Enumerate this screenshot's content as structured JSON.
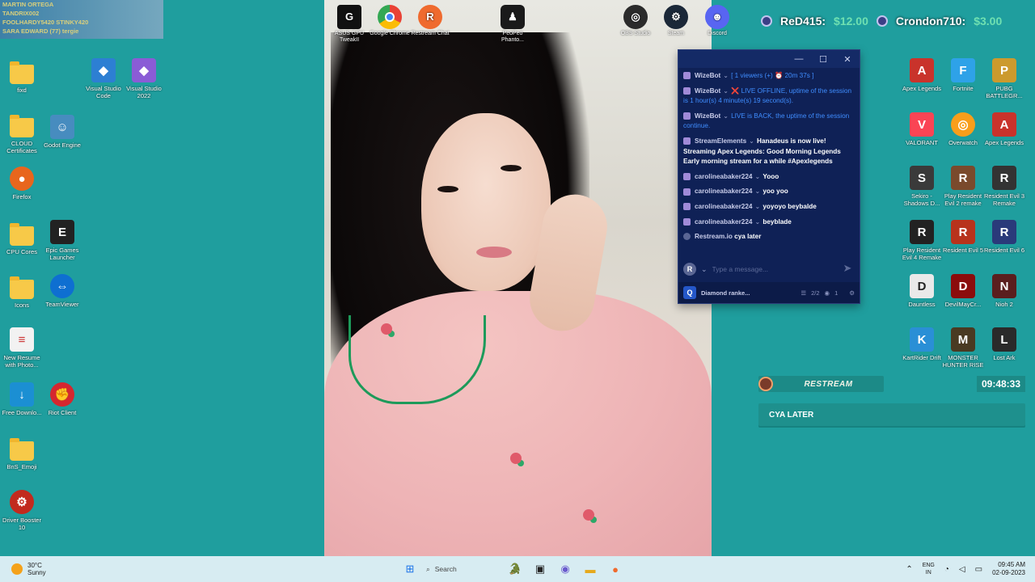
{
  "overlay": {
    "lines": [
      "MARTIN ORTEGA",
      "TANDRIX002",
      "FOOLHARDY5420 STINKY420",
      "SARA EDWARD (77) tergie"
    ]
  },
  "desktop_left": [
    {
      "label": "fixd",
      "type": "folder"
    },
    {
      "label": "Visual Studio Code",
      "type": "app",
      "color": "#2d7fd3",
      "glyph": "◆"
    },
    {
      "label": "Visual Studio 2022",
      "type": "app",
      "color": "#8a5cd6",
      "glyph": "◆"
    },
    {
      "label": "CLOUD Certificates",
      "type": "folder"
    },
    {
      "label": "Godot Engine",
      "type": "app",
      "color": "#478cbf",
      "glyph": "☺"
    },
    {
      "label": "Firefox",
      "type": "app",
      "color": "#e8661d",
      "glyph": "●"
    },
    {
      "label": "CPU Cores",
      "type": "folder"
    },
    {
      "label": "Epic Games Launcher",
      "type": "app",
      "color": "#222222",
      "glyph": "E"
    },
    {
      "label": "Icons",
      "type": "folder"
    },
    {
      "label": "TeamViewer",
      "type": "app",
      "color": "#0e6fd1",
      "glyph": "⇔"
    },
    {
      "label": "New Resume with Photo...",
      "type": "app",
      "color": "#f2f2f2",
      "glyph": "≡"
    },
    {
      "label": "Free Downlo...",
      "type": "app",
      "color": "#1b8fd3",
      "glyph": "↓"
    },
    {
      "label": "Riot Client",
      "type": "app",
      "color": "#d5272f",
      "glyph": "✊"
    },
    {
      "label": "BnS_Emoji",
      "type": "folder"
    },
    {
      "label": "Driver Booster 10",
      "type": "app",
      "color": "#c22a1e",
      "glyph": "⚙"
    }
  ],
  "top_icons": [
    {
      "label": "ASUS GPU TweakII",
      "color": "#111111",
      "glyph": "G"
    },
    {
      "label": "Google Chrome",
      "color": "#e94235",
      "glyph": "◉"
    },
    {
      "label": "Restream Chat",
      "color": "#ef6a2e",
      "glyph": "R"
    },
    {
      "label": "PeoPeo Phanto...",
      "color": "#1a1a1a",
      "glyph": "♟"
    },
    {
      "label": "OBS Studio",
      "color": "#2b2b2b",
      "glyph": "◎"
    },
    {
      "label": "Steam",
      "color": "#1b2838",
      "glyph": "⚙"
    },
    {
      "label": "Discord",
      "color": "#5865f2",
      "glyph": "☻"
    }
  ],
  "ticker": [
    {
      "name": "ReD415:",
      "amount": "$12.00"
    },
    {
      "name": "Crondon710:",
      "amount": "$3.00"
    }
  ],
  "chat": {
    "window_controls": {
      "minimize": "—",
      "maximize": "☐",
      "close": "✕"
    },
    "messages": [
      {
        "user": "WizeBot",
        "text": "[ 1 viewers (+) ⏰ 20m 37s ]",
        "system": true
      },
      {
        "user": "WizeBot",
        "text": "❌ LIVE OFFLINE, uptime of the session is 1 hour(s) 4 minute(s) 19 second(s).",
        "system": true
      },
      {
        "user": "WizeBot",
        "text": "LIVE is BACK, the uptime of the session continue.",
        "system": true
      },
      {
        "user": "StreamElements",
        "text": "Hanadeus is now live! Streaming Apex Legends: Good Morning Legends Early morning stream for a while #Apexlegends",
        "system": false
      },
      {
        "user": "carolineabaker224",
        "text": "Yooo",
        "system": false
      },
      {
        "user": "carolineabaker224",
        "text": "yoo yoo",
        "system": false
      },
      {
        "user": "carolineabaker224",
        "text": "yoyoyo beybalde",
        "system": false
      },
      {
        "user": "carolineabaker224",
        "text": "beyblade",
        "system": false
      },
      {
        "user": "Restream.io",
        "text": "cya later",
        "system": false
      }
    ],
    "input_badge": "R",
    "placeholder": "Type a message...",
    "footer": {
      "icon": "Q",
      "title": "Diamond ranke...",
      "count": "2/2",
      "viewers": "1"
    }
  },
  "restream_widget": {
    "title": "RESTREAM",
    "time": "09:48:33",
    "message": "CYA LATER"
  },
  "desktop_right": [
    {
      "label": "Apex Legends",
      "color": "#c9332b",
      "glyph": "A"
    },
    {
      "label": "Fortnite",
      "color": "#2ea2e8",
      "glyph": "F"
    },
    {
      "label": "PUBG BATTLEGR...",
      "color": "#cc9a2d",
      "glyph": "P"
    },
    {
      "label": "VALORANT",
      "color": "#fa4454",
      "glyph": "V"
    },
    {
      "label": "Overwatch",
      "color": "#f99e1a",
      "glyph": "◎"
    },
    {
      "label": "Apex Legends",
      "color": "#c9332b",
      "glyph": "A"
    },
    {
      "label": "Sekiro - Shadows D...",
      "color": "#3a3a3a",
      "glyph": "S"
    },
    {
      "label": "Play Resident Evil 2 remake",
      "color": "#7a4a2c",
      "glyph": "R"
    },
    {
      "label": "Resident Evil 3 Remake",
      "color": "#333333",
      "glyph": "R"
    },
    {
      "label": "Play Resident Evil 4 Remake",
      "color": "#222222",
      "glyph": "R"
    },
    {
      "label": "Resident Evil 5",
      "color": "#b8331c",
      "glyph": "R"
    },
    {
      "label": "Resident Evil 6",
      "color": "#2a3a7a",
      "glyph": "R"
    },
    {
      "label": "Dauntless",
      "color": "#e9e9e9",
      "glyph": "D"
    },
    {
      "label": "DevilMayCr...",
      "color": "#8b0c0c",
      "glyph": "D"
    },
    {
      "label": "Nioh 2",
      "color": "#5a1e1e",
      "glyph": "N"
    },
    {
      "label": "KartRider Drift",
      "color": "#2a8fd6",
      "glyph": "K"
    },
    {
      "label": "MONSTER HUNTER RISE",
      "color": "#4a3a22",
      "glyph": "M"
    },
    {
      "label": "Lost Ark",
      "color": "#2a2a2a",
      "glyph": "L"
    }
  ],
  "taskbar": {
    "weather_temp": "30°C",
    "weather_desc": "Sunny",
    "search_label": "Search",
    "lang_top": "ENG",
    "lang_bottom": "IN",
    "time": "09:45 AM",
    "date": "02-09-2023"
  },
  "colors": {
    "desktop": "#1f9e9e",
    "chat_bg": "#0f2156",
    "donation_amount": "#6fe0b1",
    "system_msg": "#3f8dff"
  }
}
